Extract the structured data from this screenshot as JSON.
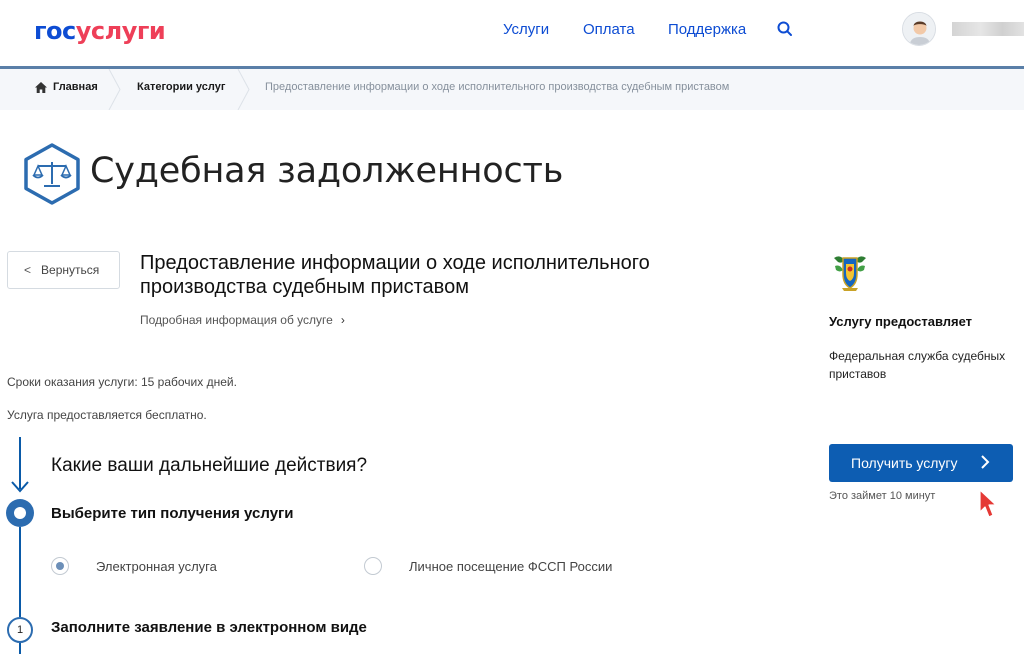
{
  "header": {
    "logo_part1": "гос",
    "logo_part2": "услуги",
    "nav": [
      "Услуги",
      "Оплата",
      "Поддержка"
    ],
    "search_icon": "search-icon",
    "avatar_icon": "user-avatar"
  },
  "breadcrumbs": {
    "home": "Главная",
    "categories": "Категории услуг",
    "current": "Предоставление информации о ходе исполнительного производства судебным приставом"
  },
  "page": {
    "title": "Судебная задолженность",
    "title_icon": "scales-icon"
  },
  "service": {
    "back_label": "Вернуться",
    "title": "Предоставление информации о ходе исполнительного производства судебным приставом",
    "details_link": "Подробная информация об услуге",
    "term": "Сроки оказания услуги: 15 рабочих дней.",
    "price": "Услуга предоставляется бесплатно."
  },
  "steps": {
    "question": "Какие ваши дальнейшие действия?",
    "step1_title": "Выберите тип получения услуги",
    "options": [
      "Электронная услуга",
      "Личное посещение ФССП России"
    ],
    "selected_option": "Электронная услуга",
    "step2_number": "1",
    "step2_title": "Заполните заявление в электронном виде"
  },
  "provider": {
    "heading": "Услугу предоставляет",
    "name": "Федеральная служба судебных приставов",
    "emblem_icon": "fssp-emblem"
  },
  "action": {
    "button_label": "Получить услугу",
    "eta": "Это займет 10 минут"
  },
  "colors": {
    "brand_blue": "#0d4cd3",
    "brand_red": "#ee3f58",
    "button_blue": "#0d5db2",
    "timeline_blue": "#2c6cb0",
    "cursor_red": "#e53935"
  }
}
